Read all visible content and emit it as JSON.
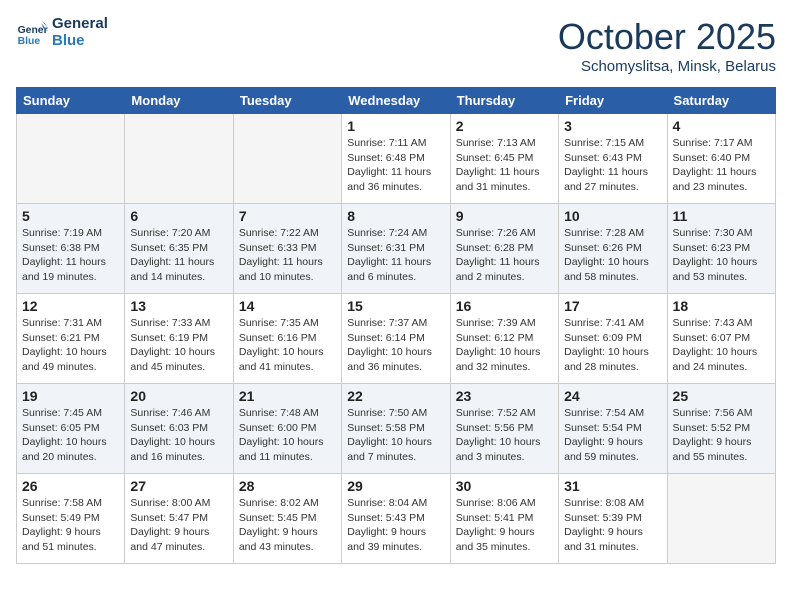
{
  "header": {
    "logo_line1": "General",
    "logo_line2": "Blue",
    "month": "October 2025",
    "location": "Schomyslitsa, Minsk, Belarus"
  },
  "days_of_week": [
    "Sunday",
    "Monday",
    "Tuesday",
    "Wednesday",
    "Thursday",
    "Friday",
    "Saturday"
  ],
  "weeks": [
    [
      {
        "day": "",
        "info": ""
      },
      {
        "day": "",
        "info": ""
      },
      {
        "day": "",
        "info": ""
      },
      {
        "day": "1",
        "info": "Sunrise: 7:11 AM\nSunset: 6:48 PM\nDaylight: 11 hours\nand 36 minutes."
      },
      {
        "day": "2",
        "info": "Sunrise: 7:13 AM\nSunset: 6:45 PM\nDaylight: 11 hours\nand 31 minutes."
      },
      {
        "day": "3",
        "info": "Sunrise: 7:15 AM\nSunset: 6:43 PM\nDaylight: 11 hours\nand 27 minutes."
      },
      {
        "day": "4",
        "info": "Sunrise: 7:17 AM\nSunset: 6:40 PM\nDaylight: 11 hours\nand 23 minutes."
      }
    ],
    [
      {
        "day": "5",
        "info": "Sunrise: 7:19 AM\nSunset: 6:38 PM\nDaylight: 11 hours\nand 19 minutes."
      },
      {
        "day": "6",
        "info": "Sunrise: 7:20 AM\nSunset: 6:35 PM\nDaylight: 11 hours\nand 14 minutes."
      },
      {
        "day": "7",
        "info": "Sunrise: 7:22 AM\nSunset: 6:33 PM\nDaylight: 11 hours\nand 10 minutes."
      },
      {
        "day": "8",
        "info": "Sunrise: 7:24 AM\nSunset: 6:31 PM\nDaylight: 11 hours\nand 6 minutes."
      },
      {
        "day": "9",
        "info": "Sunrise: 7:26 AM\nSunset: 6:28 PM\nDaylight: 11 hours\nand 2 minutes."
      },
      {
        "day": "10",
        "info": "Sunrise: 7:28 AM\nSunset: 6:26 PM\nDaylight: 10 hours\nand 58 minutes."
      },
      {
        "day": "11",
        "info": "Sunrise: 7:30 AM\nSunset: 6:23 PM\nDaylight: 10 hours\nand 53 minutes."
      }
    ],
    [
      {
        "day": "12",
        "info": "Sunrise: 7:31 AM\nSunset: 6:21 PM\nDaylight: 10 hours\nand 49 minutes."
      },
      {
        "day": "13",
        "info": "Sunrise: 7:33 AM\nSunset: 6:19 PM\nDaylight: 10 hours\nand 45 minutes."
      },
      {
        "day": "14",
        "info": "Sunrise: 7:35 AM\nSunset: 6:16 PM\nDaylight: 10 hours\nand 41 minutes."
      },
      {
        "day": "15",
        "info": "Sunrise: 7:37 AM\nSunset: 6:14 PM\nDaylight: 10 hours\nand 36 minutes."
      },
      {
        "day": "16",
        "info": "Sunrise: 7:39 AM\nSunset: 6:12 PM\nDaylight: 10 hours\nand 32 minutes."
      },
      {
        "day": "17",
        "info": "Sunrise: 7:41 AM\nSunset: 6:09 PM\nDaylight: 10 hours\nand 28 minutes."
      },
      {
        "day": "18",
        "info": "Sunrise: 7:43 AM\nSunset: 6:07 PM\nDaylight: 10 hours\nand 24 minutes."
      }
    ],
    [
      {
        "day": "19",
        "info": "Sunrise: 7:45 AM\nSunset: 6:05 PM\nDaylight: 10 hours\nand 20 minutes."
      },
      {
        "day": "20",
        "info": "Sunrise: 7:46 AM\nSunset: 6:03 PM\nDaylight: 10 hours\nand 16 minutes."
      },
      {
        "day": "21",
        "info": "Sunrise: 7:48 AM\nSunset: 6:00 PM\nDaylight: 10 hours\nand 11 minutes."
      },
      {
        "day": "22",
        "info": "Sunrise: 7:50 AM\nSunset: 5:58 PM\nDaylight: 10 hours\nand 7 minutes."
      },
      {
        "day": "23",
        "info": "Sunrise: 7:52 AM\nSunset: 5:56 PM\nDaylight: 10 hours\nand 3 minutes."
      },
      {
        "day": "24",
        "info": "Sunrise: 7:54 AM\nSunset: 5:54 PM\nDaylight: 9 hours\nand 59 minutes."
      },
      {
        "day": "25",
        "info": "Sunrise: 7:56 AM\nSunset: 5:52 PM\nDaylight: 9 hours\nand 55 minutes."
      }
    ],
    [
      {
        "day": "26",
        "info": "Sunrise: 7:58 AM\nSunset: 5:49 PM\nDaylight: 9 hours\nand 51 minutes."
      },
      {
        "day": "27",
        "info": "Sunrise: 8:00 AM\nSunset: 5:47 PM\nDaylight: 9 hours\nand 47 minutes."
      },
      {
        "day": "28",
        "info": "Sunrise: 8:02 AM\nSunset: 5:45 PM\nDaylight: 9 hours\nand 43 minutes."
      },
      {
        "day": "29",
        "info": "Sunrise: 8:04 AM\nSunset: 5:43 PM\nDaylight: 9 hours\nand 39 minutes."
      },
      {
        "day": "30",
        "info": "Sunrise: 8:06 AM\nSunset: 5:41 PM\nDaylight: 9 hours\nand 35 minutes."
      },
      {
        "day": "31",
        "info": "Sunrise: 8:08 AM\nSunset: 5:39 PM\nDaylight: 9 hours\nand 31 minutes."
      },
      {
        "day": "",
        "info": ""
      }
    ]
  ]
}
